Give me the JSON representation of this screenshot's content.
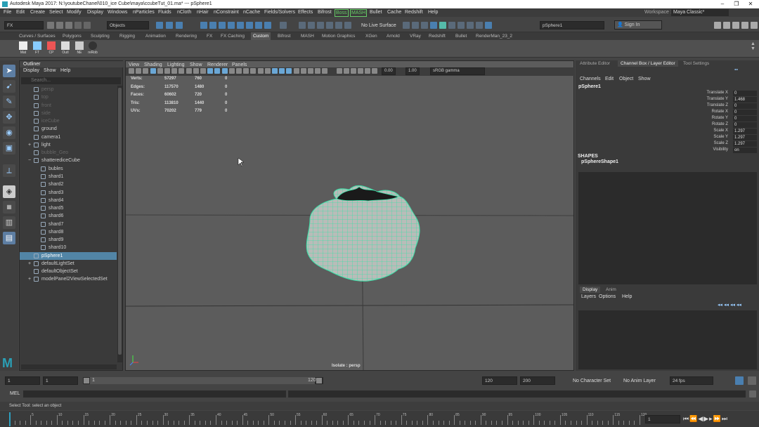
{
  "title": "Autodesk Maya 2017: N:\\youtubeChanel\\010_ice Cube\\maya\\ccubeTut_01.ma*  ---  pSphere1",
  "window_controls": {
    "min": "–",
    "max": "❐",
    "close": "✕"
  },
  "menubar": [
    "File",
    "Edit",
    "Create",
    "Select",
    "Modify",
    "Display",
    "Windows",
    "nParticles",
    "Fluids",
    "nCloth",
    "nHair",
    "nConstraint",
    "nCache",
    "Fields/Solvers",
    "Effects",
    "Bifrost",
    "Boss",
    "MASH",
    "Bullet",
    "Cache",
    "Redshift",
    "Help"
  ],
  "workspace": {
    "label": "Workspace :",
    "value": "Maya Classic*"
  },
  "status": {
    "menuset": "FX",
    "select_mode": "Objects",
    "live_surface": "No Live Surface",
    "object_name": "pSphere1",
    "sign_in": "Sign In"
  },
  "shelf_tabs": [
    "Curves / Surfaces",
    "Polygons",
    "Sculpting",
    "Rigging",
    "Animation",
    "Rendering",
    "FX",
    "FX Caching",
    "Custom",
    "Bifrost",
    "MASH",
    "Motion Graphics",
    "XGen",
    "Arnold",
    "VRay",
    "Redshift",
    "Bullet",
    "RenderMan_23_2"
  ],
  "shelf_active": "Custom",
  "shelf_buttons": [
    "Mat",
    "FT",
    "CP",
    "Outl",
    "NE",
    "reRob"
  ],
  "outliner": {
    "title": "Outliner",
    "menus": [
      "Display",
      "Show",
      "Help"
    ],
    "search_placeholder": "Search...",
    "items": [
      {
        "label": "persp",
        "indent": 1,
        "dim": true
      },
      {
        "label": "top",
        "indent": 1,
        "dim": true
      },
      {
        "label": "front",
        "indent": 1,
        "dim": true
      },
      {
        "label": "side",
        "indent": 1,
        "dim": true
      },
      {
        "label": "iceCube",
        "indent": 1,
        "dim": true
      },
      {
        "label": "ground",
        "indent": 1,
        "dim": false
      },
      {
        "label": "camera1",
        "indent": 1,
        "dim": false
      },
      {
        "label": "light",
        "indent": 1,
        "dim": false,
        "expand": "+"
      },
      {
        "label": "bubble_Geo",
        "indent": 1,
        "dim": true
      },
      {
        "label": "shatterediceCube",
        "indent": 1,
        "dim": false,
        "expand": "−"
      },
      {
        "label": "bubles",
        "indent": 2,
        "dim": false
      },
      {
        "label": "shard1",
        "indent": 2,
        "dim": false
      },
      {
        "label": "shard2",
        "indent": 2,
        "dim": false
      },
      {
        "label": "shard3",
        "indent": 2,
        "dim": false
      },
      {
        "label": "shard4",
        "indent": 2,
        "dim": false
      },
      {
        "label": "shard5",
        "indent": 2,
        "dim": false
      },
      {
        "label": "shard6",
        "indent": 2,
        "dim": false
      },
      {
        "label": "shard7",
        "indent": 2,
        "dim": false
      },
      {
        "label": "shard8",
        "indent": 2,
        "dim": false
      },
      {
        "label": "shard9",
        "indent": 2,
        "dim": false
      },
      {
        "label": "shard10",
        "indent": 2,
        "dim": false
      },
      {
        "label": "pSphere1",
        "indent": 1,
        "dim": false,
        "selected": true
      },
      {
        "label": "defaultLightSet",
        "indent": 1,
        "dim": false,
        "expand": "+"
      },
      {
        "label": "defaultObjectSet",
        "indent": 1,
        "dim": false
      },
      {
        "label": "modelPanel2ViewSelectedSet",
        "indent": 1,
        "dim": false,
        "expand": "+"
      }
    ]
  },
  "viewport": {
    "menus": [
      "View",
      "Shading",
      "Lighting",
      "Show",
      "Renderer",
      "Panels"
    ],
    "exposure": "0.00",
    "gamma": "1.00",
    "color_space": "sRGB gamma",
    "hud": [
      {
        "k": "Verts:",
        "a": "57297",
        "b": "760",
        "c": "0"
      },
      {
        "k": "Edges:",
        "a": "117570",
        "b": "1480",
        "c": "0"
      },
      {
        "k": "Faces:",
        "a": "60602",
        "b": "720",
        "c": "0"
      },
      {
        "k": "Tris:",
        "a": "113810",
        "b": "1440",
        "c": "0"
      },
      {
        "k": "UVs:",
        "a": "70202",
        "b": "779",
        "c": "0"
      }
    ],
    "isolate_label": "Isolate : persp"
  },
  "right_panel": {
    "tabs": [
      "Attribute Editor",
      "Channel Box / Layer Editor",
      "Tool Settings"
    ],
    "active_tab": "Channel Box / Layer Editor",
    "menus": [
      "Channels",
      "Edit",
      "Object",
      "Show"
    ],
    "object": "pSphere1",
    "channels": [
      {
        "name": "Translate X",
        "value": "0"
      },
      {
        "name": "Translate Y",
        "value": "1.468"
      },
      {
        "name": "Translate Z",
        "value": "0"
      },
      {
        "name": "Rotate X",
        "value": "0"
      },
      {
        "name": "Rotate Y",
        "value": "0"
      },
      {
        "name": "Rotate Z",
        "value": "0"
      },
      {
        "name": "Scale X",
        "value": "1.297"
      },
      {
        "name": "Scale Y",
        "value": "1.297"
      },
      {
        "name": "Scale Z",
        "value": "1.297"
      },
      {
        "name": "Visibility",
        "value": "on"
      }
    ],
    "shapes_label": "SHAPES",
    "shape_name": "pSphereShape1",
    "layer_tabs": [
      "Display",
      "Anim"
    ],
    "layer_menus": [
      "Layers",
      "Options",
      "Help"
    ]
  },
  "timeline": {
    "start": "1",
    "current_start": "1",
    "range_start": "1",
    "range_end": "120",
    "end": "120",
    "max": "200",
    "character_set": "No Character Set",
    "anim_layer": "No Anim Layer",
    "fps": "24 fps",
    "current_frame": "1",
    "ticks": [
      "5",
      "10",
      "15",
      "20",
      "25",
      "30",
      "35",
      "40",
      "45",
      "50",
      "55",
      "60",
      "65",
      "70",
      "75",
      "80",
      "85",
      "90",
      "95",
      "100",
      "105",
      "110",
      "115",
      "120"
    ]
  },
  "mel": {
    "label": "MEL"
  },
  "help_line": "Select Tool: select an object",
  "colors": {
    "wire": "#3de0a8",
    "selection": "#5285a6",
    "viewport_bg": "#5c5c5c"
  }
}
